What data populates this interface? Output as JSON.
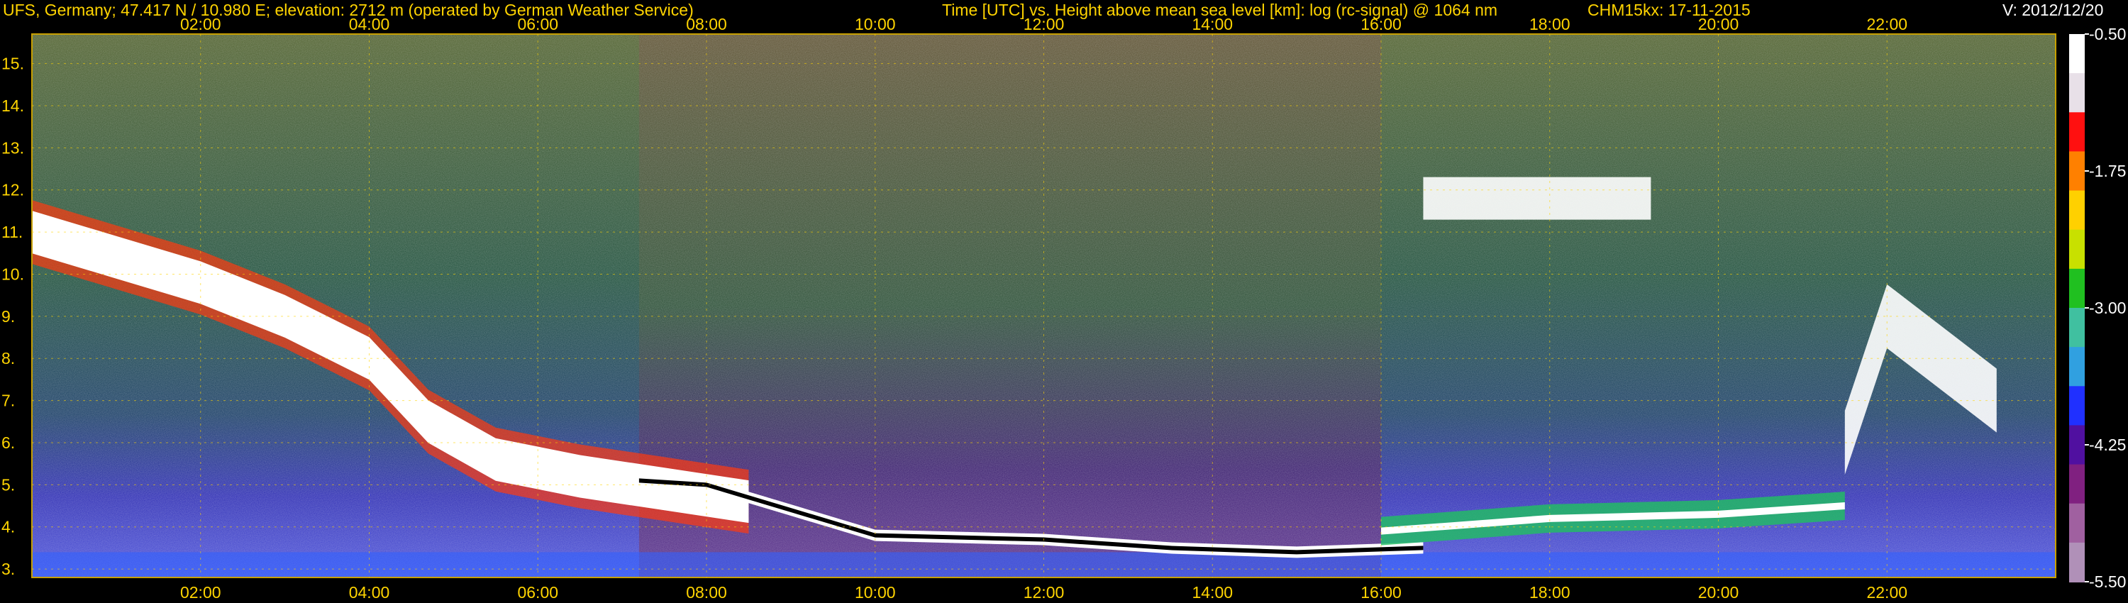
{
  "header": {
    "station": "UFS, Germany; 47.417 N / 10.980 E; elevation: 2712 m  (operated by German Weather Service)",
    "axes_title": "Time [UTC] vs. Height above mean sea level [km]: log (rc-signal) @ 1064 nm",
    "instrument": "CHM15kx: 17-11-2015",
    "version": "V: 2012/12/20"
  },
  "chart_data": {
    "type": "heatmap",
    "title": "Time [UTC] vs. Height above mean sea level [km]: log (rc-signal) @ 1064 nm",
    "xlabel": "Time [UTC]",
    "ylabel": "Height above mean sea level [km]",
    "x_range_hours": [
      0,
      24
    ],
    "y_range_km": [
      2.8,
      15.7
    ],
    "x_ticks": [
      "02:00",
      "04:00",
      "06:00",
      "08:00",
      "10:00",
      "12:00",
      "14:00",
      "16:00",
      "18:00",
      "20:00",
      "22:00"
    ],
    "x_tick_hours": [
      2,
      4,
      6,
      8,
      10,
      12,
      14,
      16,
      18,
      20,
      22
    ],
    "y_ticks": [
      "3.",
      "4.",
      "5.",
      "6.",
      "7.",
      "8.",
      "9.",
      "10.",
      "11.",
      "12.",
      "13.",
      "14.",
      "15."
    ],
    "y_tick_values": [
      3,
      4,
      5,
      6,
      7,
      8,
      9,
      10,
      11,
      12,
      13,
      14,
      15
    ],
    "grid": true,
    "colorbar": {
      "labels": [
        "-0.50",
        "-1.75",
        "-3.00",
        "-4.25",
        "-5.50"
      ],
      "values": [
        -0.5,
        -1.75,
        -3.0,
        -4.25,
        -5.5
      ],
      "range": [
        -5.5,
        -0.5
      ],
      "colors": [
        "#ffffff",
        "#e8e0e8",
        "#ff1010",
        "#ff8000",
        "#ffd000",
        "#c8e000",
        "#20c020",
        "#40c0a0",
        "#30a0e0",
        "#2030ff",
        "#5010a0",
        "#802080",
        "#a060a0",
        "#b090b8"
      ]
    },
    "features": {
      "cirrus_layer_km": [
        [
          0.0,
          11.0
        ],
        [
          1.0,
          10.4
        ],
        [
          2.0,
          9.8
        ],
        [
          3.0,
          9.0
        ],
        [
          4.0,
          8.0
        ],
        [
          4.7,
          6.5
        ],
        [
          5.5,
          5.6
        ],
        [
          6.5,
          5.2
        ],
        [
          7.5,
          4.9
        ],
        [
          8.5,
          4.6
        ]
      ],
      "boundary_layer_top_km": [
        [
          7.2,
          5.1
        ],
        [
          8.0,
          5.0
        ],
        [
          9.0,
          4.4
        ],
        [
          10.0,
          3.8
        ],
        [
          12.0,
          3.7
        ],
        [
          13.5,
          3.5
        ],
        [
          15.0,
          3.4
        ],
        [
          16.5,
          3.5
        ]
      ],
      "upper_cloud_km": [
        [
          16.5,
          11.8
        ],
        [
          19.2,
          11.8
        ]
      ],
      "late_cloud_km": [
        [
          21.5,
          6.0
        ],
        [
          22.0,
          9.0
        ],
        [
          23.3,
          7.0
        ]
      ],
      "aerosol_layer_km": [
        [
          16.0,
          3.9
        ],
        [
          18.0,
          4.2
        ],
        [
          20.0,
          4.3
        ],
        [
          21.5,
          4.5
        ]
      ]
    }
  }
}
